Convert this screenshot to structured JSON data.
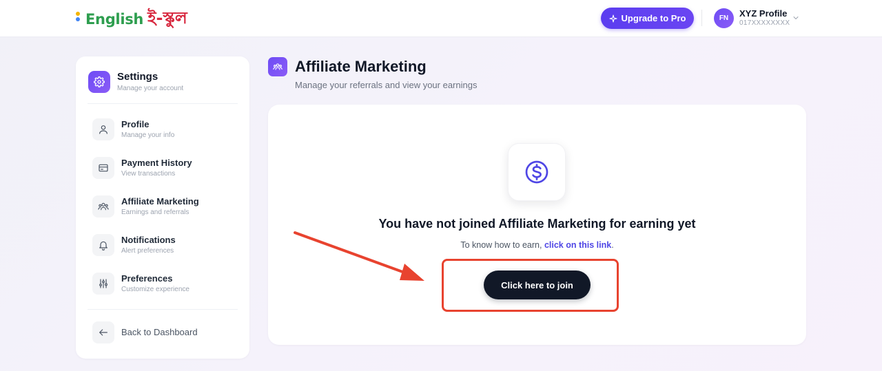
{
  "header": {
    "logo_text_en": "English",
    "logo_text_bn": "ই-স্কুল",
    "upgrade_label": "Upgrade to Pro",
    "avatar_initials": "FN",
    "profile_name": "XYZ Profile",
    "profile_phone": "017XXXXXXXX"
  },
  "sidebar": {
    "title": "Settings",
    "subtitle": "Manage your account",
    "items": [
      {
        "label": "Profile",
        "sub": "Manage your info",
        "icon": "user-icon"
      },
      {
        "label": "Payment History",
        "sub": "View transactions",
        "icon": "credit-card-icon"
      },
      {
        "label": "Affiliate Marketing",
        "sub": "Earnings and referrals",
        "icon": "users-icon"
      },
      {
        "label": "Notifications",
        "sub": "Alert preferences",
        "icon": "bell-icon"
      },
      {
        "label": "Preferences",
        "sub": "Customize experience",
        "icon": "sliders-icon"
      }
    ],
    "back_label": "Back to Dashboard"
  },
  "main": {
    "title": "Affiliate Marketing",
    "subtitle": "Manage your referrals and view your earnings",
    "empty_title": "You have not joined Affiliate Marketing for earning yet",
    "empty_text_prefix": "To know how to earn, ",
    "empty_text_link": "click on this link",
    "empty_text_suffix": ".",
    "join_label": "Click here to join"
  },
  "colors": {
    "accent": "#6d4cf5",
    "annotation": "#e8432f",
    "join_button": "#111827"
  }
}
